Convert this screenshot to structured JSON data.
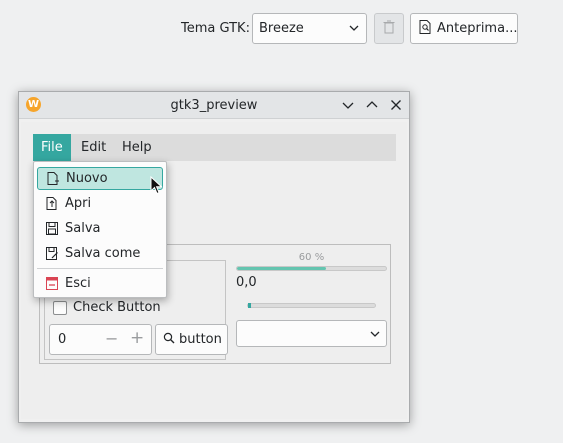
{
  "settings": {
    "gtk_label": "Tema GTK:",
    "theme_value": "Breeze",
    "preview_label": "Anteprima..."
  },
  "window": {
    "title": "gtk3_preview",
    "app_icon_letter": "W",
    "menubar": [
      "File",
      "Edit",
      "Help"
    ],
    "file_menu": [
      {
        "label": "Nuovo",
        "icon": "new-file-icon"
      },
      {
        "label": "Apri",
        "icon": "open-file-icon"
      },
      {
        "label": "Salva",
        "icon": "save-icon"
      },
      {
        "label": "Salva come",
        "icon": "save-as-icon"
      },
      {
        "label": "Esci",
        "icon": "exit-icon"
      }
    ],
    "check_label": "Check Button",
    "spin_value": "0",
    "search_button_label": "button",
    "progress_label": "60 %",
    "progress_value": 0.6,
    "level_value": "0,0",
    "slider_value": 0.0
  },
  "colors": {
    "accent": "#35a7a0",
    "progress_fill": "#64c5b0",
    "exit_red": "#da4453"
  }
}
